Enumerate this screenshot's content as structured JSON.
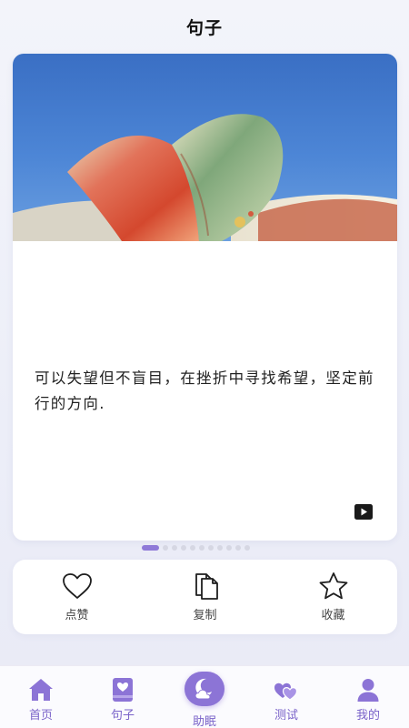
{
  "header": {
    "title": "句子"
  },
  "card": {
    "quote": "可以失望但不盲目，在挫折中寻找希望，坚定前行的方向."
  },
  "pager": {
    "count": 11,
    "active_index": 0
  },
  "actions": [
    {
      "label": "点赞",
      "icon": "heart-outline-icon"
    },
    {
      "label": "复制",
      "icon": "copy-icon"
    },
    {
      "label": "收藏",
      "icon": "star-outline-icon"
    }
  ],
  "tabs": [
    {
      "label": "首页",
      "icon": "home-icon"
    },
    {
      "label": "句子",
      "icon": "book-heart-icon"
    },
    {
      "label": "助眠",
      "icon": "moon-cloud-icon"
    },
    {
      "label": "测试",
      "icon": "hearts-icon"
    },
    {
      "label": "我的",
      "icon": "user-icon"
    }
  ],
  "colors": {
    "accent": "#8c74d6",
    "tab_label": "#7a63c9",
    "pager_active": "#8f7ad8",
    "pager_inactive": "#d6d7e3"
  }
}
